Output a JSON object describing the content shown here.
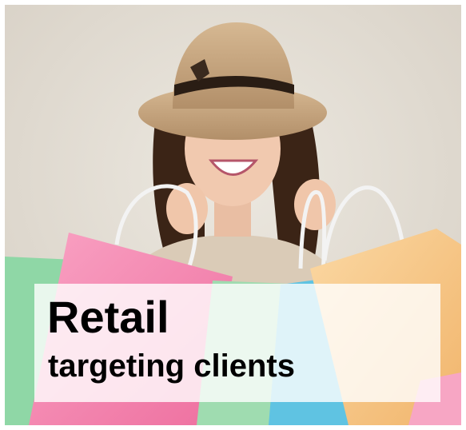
{
  "caption": {
    "title": "Retail",
    "subtitle": "targeting clients"
  },
  "colors": {
    "background": "#e2ddd3",
    "hat": "#c9a67e",
    "hat_band": "#2a1d14",
    "hair": "#3b2416",
    "skin": "#f0c8ae",
    "sweater": "#d9cbb8",
    "bag_green": "#8fd7a6",
    "bag_pink": "#f58bb2",
    "bag_orange": "#f7c98b",
    "bag_blue": "#5fc3e2",
    "caption_text": "#000000"
  }
}
